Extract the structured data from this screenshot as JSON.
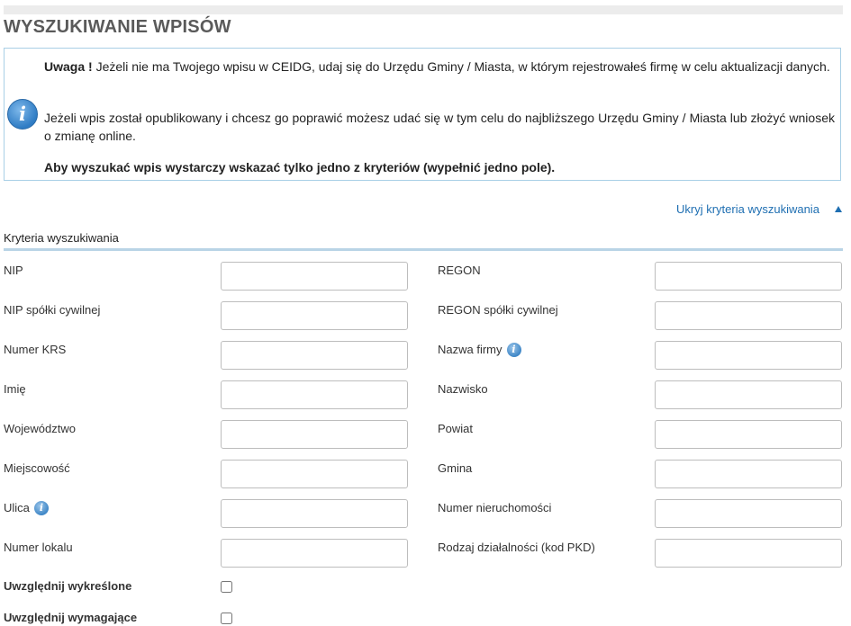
{
  "page": {
    "title": "WYSZUKIWANIE WPISÓW"
  },
  "info": {
    "icon": "info-icon",
    "p1_bold": "Uwaga !",
    "p1_rest": " Jeżeli nie ma Twojego wpisu w CEIDG, udaj się do Urzędu Gminy / Miasta, w którym rejestrowałeś firmę w celu aktualizacji danych.",
    "p2": "Jeżeli wpis został opublikowany i chcesz go poprawić możesz udać się w tym celu do najbliższego Urzędu Gminy / Miasta lub złożyć wniosek o zmianę online.",
    "p3": "Aby wyszukać wpis wystarczy wskazać tylko jedno z kryteriów (wypełnić jedno pole)."
  },
  "toggle": {
    "label": "Ukryj kryteria wyszukiwania",
    "icon": "triangle-up-icon"
  },
  "criteria": {
    "section_label": "Kryteria wyszukiwania",
    "fields": [
      {
        "label": "NIP",
        "value": "",
        "help": false
      },
      {
        "label": "REGON",
        "value": "",
        "help": false
      },
      {
        "label": "NIP spółki cywilnej",
        "value": "",
        "help": false
      },
      {
        "label": "REGON spółki cywilnej",
        "value": "",
        "help": false
      },
      {
        "label": "Numer KRS",
        "value": "",
        "help": false
      },
      {
        "label": "Nazwa firmy",
        "value": "",
        "help": true
      },
      {
        "label": "Imię",
        "value": "",
        "help": false
      },
      {
        "label": "Nazwisko",
        "value": "",
        "help": false
      },
      {
        "label": "Województwo",
        "value": "",
        "help": false
      },
      {
        "label": "Powiat",
        "value": "",
        "help": false
      },
      {
        "label": "Miejscowość",
        "value": "",
        "help": false
      },
      {
        "label": "Gmina",
        "value": "",
        "help": false
      },
      {
        "label": "Ulica",
        "value": "",
        "help": true
      },
      {
        "label": "Numer nieruchomości",
        "value": "",
        "help": false
      },
      {
        "label": "Numer lokalu",
        "value": "",
        "help": false
      },
      {
        "label": "Rodzaj działalności (kod PKD)",
        "value": "",
        "help": false
      }
    ],
    "checkboxes": [
      {
        "label": "Uwzględnij wykreślone",
        "checked": false
      },
      {
        "label": "Uwzględnij wymagające",
        "checked": false
      }
    ]
  },
  "colors": {
    "link": "#1f6fb2",
    "box_border": "#a9cfe6",
    "section_rule": "#b9d4e6"
  }
}
